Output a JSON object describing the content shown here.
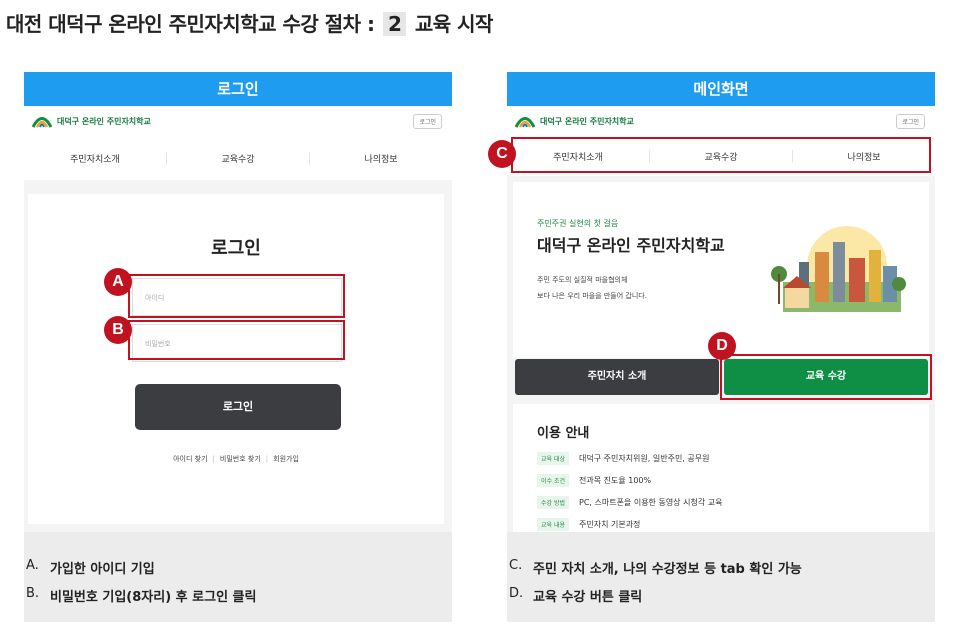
{
  "page": {
    "title_prefix": "대전 대덕구 온라인 주민자치학교 수강 절차 :",
    "step_number": "2",
    "title_suffix": "교육 시작"
  },
  "site": {
    "name": "대덕구 온라인 주민자치학교",
    "login_button_small": "로그인",
    "tabs": [
      "주민자치소개",
      "교육수강",
      "나의정보"
    ]
  },
  "left_panel": {
    "header": "로그인",
    "login_title": "로그인",
    "id_placeholder": "아이디",
    "pw_placeholder": "비밀번호",
    "login_button": "로그인",
    "links": [
      "아이디 찾기",
      "비밀번호 찾기",
      "회원가입"
    ]
  },
  "right_panel": {
    "header": "메인화면",
    "hero_kicker": "주민주권 실현의 첫 걸음",
    "hero_title": "대덕구 온라인 주민자치학교",
    "hero_desc_1": "주민 주도의 실질적 마을협의체",
    "hero_desc_2": "보다 나은 우리 마을을 만들어 갑니다.",
    "btn_intro": "주민자치 소개",
    "btn_course": "교육 수강",
    "info_title": "이용 안내",
    "info_rows": [
      {
        "tag": "교육 대상",
        "text": "대덕구 주민자치위원, 일반주민, 공무원"
      },
      {
        "tag": "이수 조건",
        "text": "전과목 진도율 100%"
      },
      {
        "tag": "수강 방법",
        "text": "PC, 스마트폰을 이용한 동영상 시청각 교육"
      },
      {
        "tag": "교육 내용",
        "text": "주민자치 기본과정"
      }
    ]
  },
  "badges": {
    "a": "A",
    "b": "B",
    "c": "C",
    "d": "D"
  },
  "notes_left": [
    {
      "letter": "A.",
      "text": "가입한 아이디 기입"
    },
    {
      "letter": "B.",
      "text": "비밀번호 기입(8자리) 후 로그인 클릭"
    }
  ],
  "notes_right": [
    {
      "letter": "C.",
      "text": "주민 자치 소개, 나의 수강정보 등 tab 확인 가능"
    },
    {
      "letter": "D.",
      "text": "교육 수강 버튼 클릭"
    }
  ],
  "colors": {
    "header_blue": "#1e9cf0",
    "highlight_red": "#c1121f",
    "green": "#0e8f45",
    "dark": "#3b3d40"
  }
}
